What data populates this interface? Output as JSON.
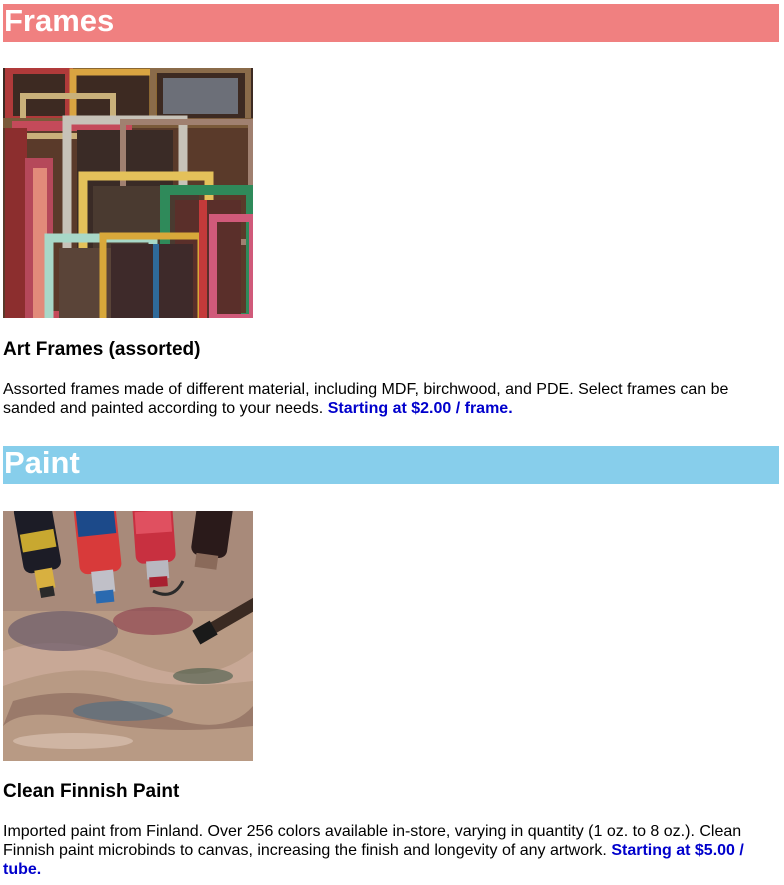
{
  "colors": {
    "frames_header_bg": "#f08080",
    "paint_header_bg": "#87ceeb",
    "price_text": "#0000cc"
  },
  "sections": [
    {
      "heading": "Frames",
      "image_subject": "stack of colorful wooden picture frames",
      "product_name": "Art Frames (assorted)",
      "description": "Assorted frames made of different material, including MDF, birchwood, and PDE. Select frames can be sanded and painted according to your needs.",
      "price": "Starting at $2.00 / frame."
    },
    {
      "heading": "Paint",
      "image_subject": "oil paint tubes on a paint-covered wooden palette",
      "product_name": "Clean Finnish Paint",
      "description": "Imported paint from Finland. Over 256 colors available in-store, varying in quantity (1 oz. to 8 oz.). Clean Finnish paint microbinds to canvas, increasing the finish and longevity of any artwork.",
      "price": "Starting at $5.00 / tube."
    }
  ]
}
